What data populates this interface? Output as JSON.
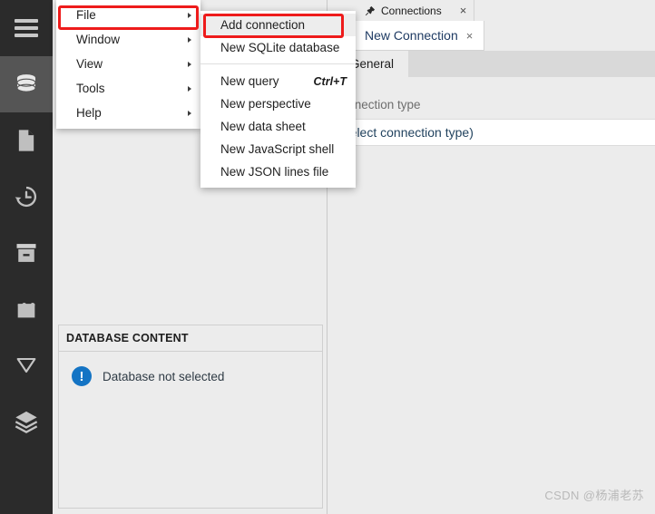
{
  "activity_bar": {
    "items": [
      {
        "name": "hamburger-menu",
        "icon": "hamburger-icon",
        "selected": false
      },
      {
        "name": "database",
        "icon": "database-icon",
        "selected": true
      },
      {
        "name": "files",
        "icon": "file-icon",
        "selected": false
      },
      {
        "name": "history",
        "icon": "history-icon",
        "selected": false
      },
      {
        "name": "archive",
        "icon": "archive-icon",
        "selected": false
      },
      {
        "name": "plugins",
        "icon": "plugin-icon",
        "selected": false
      },
      {
        "name": "filters",
        "icon": "filter-icon",
        "selected": false
      },
      {
        "name": "layers",
        "icon": "layers-icon",
        "selected": false
      }
    ]
  },
  "main_menu": {
    "items": [
      {
        "label": "File",
        "has_submenu": true,
        "highlighted": true
      },
      {
        "label": "Window",
        "has_submenu": true,
        "highlighted": false
      },
      {
        "label": "View",
        "has_submenu": true,
        "highlighted": false
      },
      {
        "label": "Tools",
        "has_submenu": true,
        "highlighted": false
      },
      {
        "label": "Help",
        "has_submenu": true,
        "highlighted": false
      }
    ]
  },
  "file_submenu": {
    "group1": [
      {
        "label": "Add connection",
        "shortcut": "",
        "hovered": true,
        "highlighted": true
      },
      {
        "label": "New SQLite database",
        "shortcut": "",
        "hovered": false,
        "highlighted": false
      }
    ],
    "group2": [
      {
        "label": "New query",
        "shortcut": "Ctrl+T",
        "hovered": false,
        "highlighted": false
      },
      {
        "label": "New perspective",
        "shortcut": "",
        "hovered": false,
        "highlighted": false
      },
      {
        "label": "New data sheet",
        "shortcut": "",
        "hovered": false,
        "highlighted": false
      },
      {
        "label": "New JavaScript shell",
        "shortcut": "",
        "hovered": false,
        "highlighted": false
      },
      {
        "label": "New JSON lines file",
        "shortcut": "",
        "hovered": false,
        "highlighted": false
      }
    ]
  },
  "left_panel": {
    "database_content": {
      "header": "DATABASE CONTENT",
      "status_text": "Database not selected",
      "status_icon": "info-icon"
    }
  },
  "editor": {
    "tab": {
      "label": "Connections",
      "pin_icon": "pin-icon",
      "close": "×"
    },
    "inner_tab": {
      "label": "New Connection",
      "close": "×"
    },
    "sub_tab": {
      "label": "General"
    },
    "form": {
      "connection_type_label": "Connection type",
      "connection_type_value": "(select connection type)"
    }
  },
  "watermark": {
    "text": "CSDN @杨浦老苏"
  },
  "colors": {
    "activity_bar_bg": "#2b2b2b",
    "activity_selected_bg": "#555555",
    "panel_bg": "#ececec",
    "highlight_red": "#ee1b1b",
    "info_blue": "#1474c4",
    "link_blue": "#1f3b63"
  }
}
